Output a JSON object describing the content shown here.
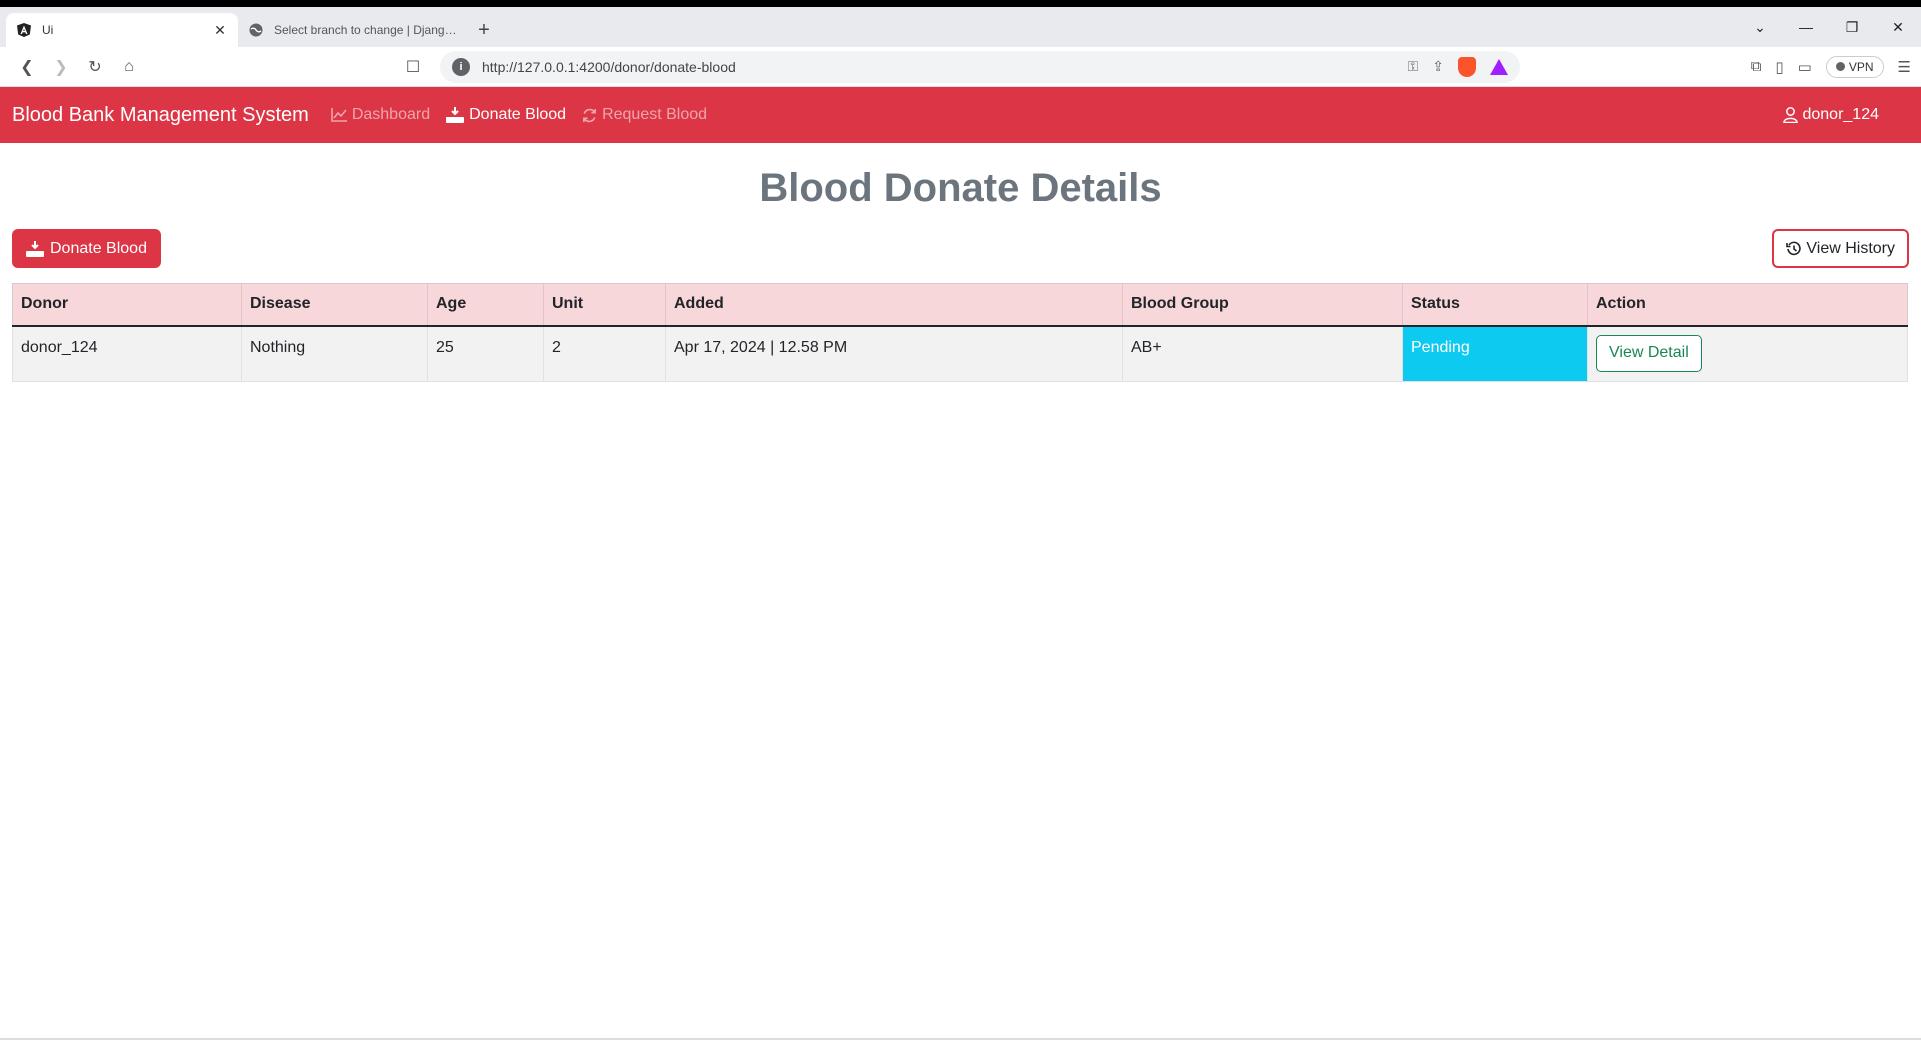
{
  "browser": {
    "tabs": [
      {
        "title": "Ui",
        "active": true
      },
      {
        "title": "Select branch to change | Django site",
        "active": false
      }
    ],
    "url": "http://127.0.0.1:4200/donor/donate-blood",
    "vpn_label": "VPN"
  },
  "navbar": {
    "brand": "Blood Bank Management System",
    "links": [
      {
        "label": "Dashboard",
        "icon": "chart-line-icon"
      },
      {
        "label": "Donate Blood",
        "icon": "hand-holding-icon"
      },
      {
        "label": "Request Blood",
        "icon": "refresh-icon"
      }
    ],
    "user": "donor_124",
    "color": "#dc3545"
  },
  "page": {
    "title": "Blood Donate Details",
    "donate_button": "Donate Blood",
    "history_button": "View History"
  },
  "table": {
    "headers": [
      "Donor",
      "Disease",
      "Age",
      "Unit",
      "Added",
      "Blood Group",
      "Status",
      "Action"
    ],
    "rows": [
      {
        "donor": "donor_124",
        "disease": "Nothing",
        "age": "25",
        "unit": "2",
        "added": "Apr 17, 2024 | 12.58 PM",
        "blood_group": "AB+",
        "status": "Pending",
        "action": "View Detail"
      }
    ],
    "status_color": "#0dcaf0"
  }
}
